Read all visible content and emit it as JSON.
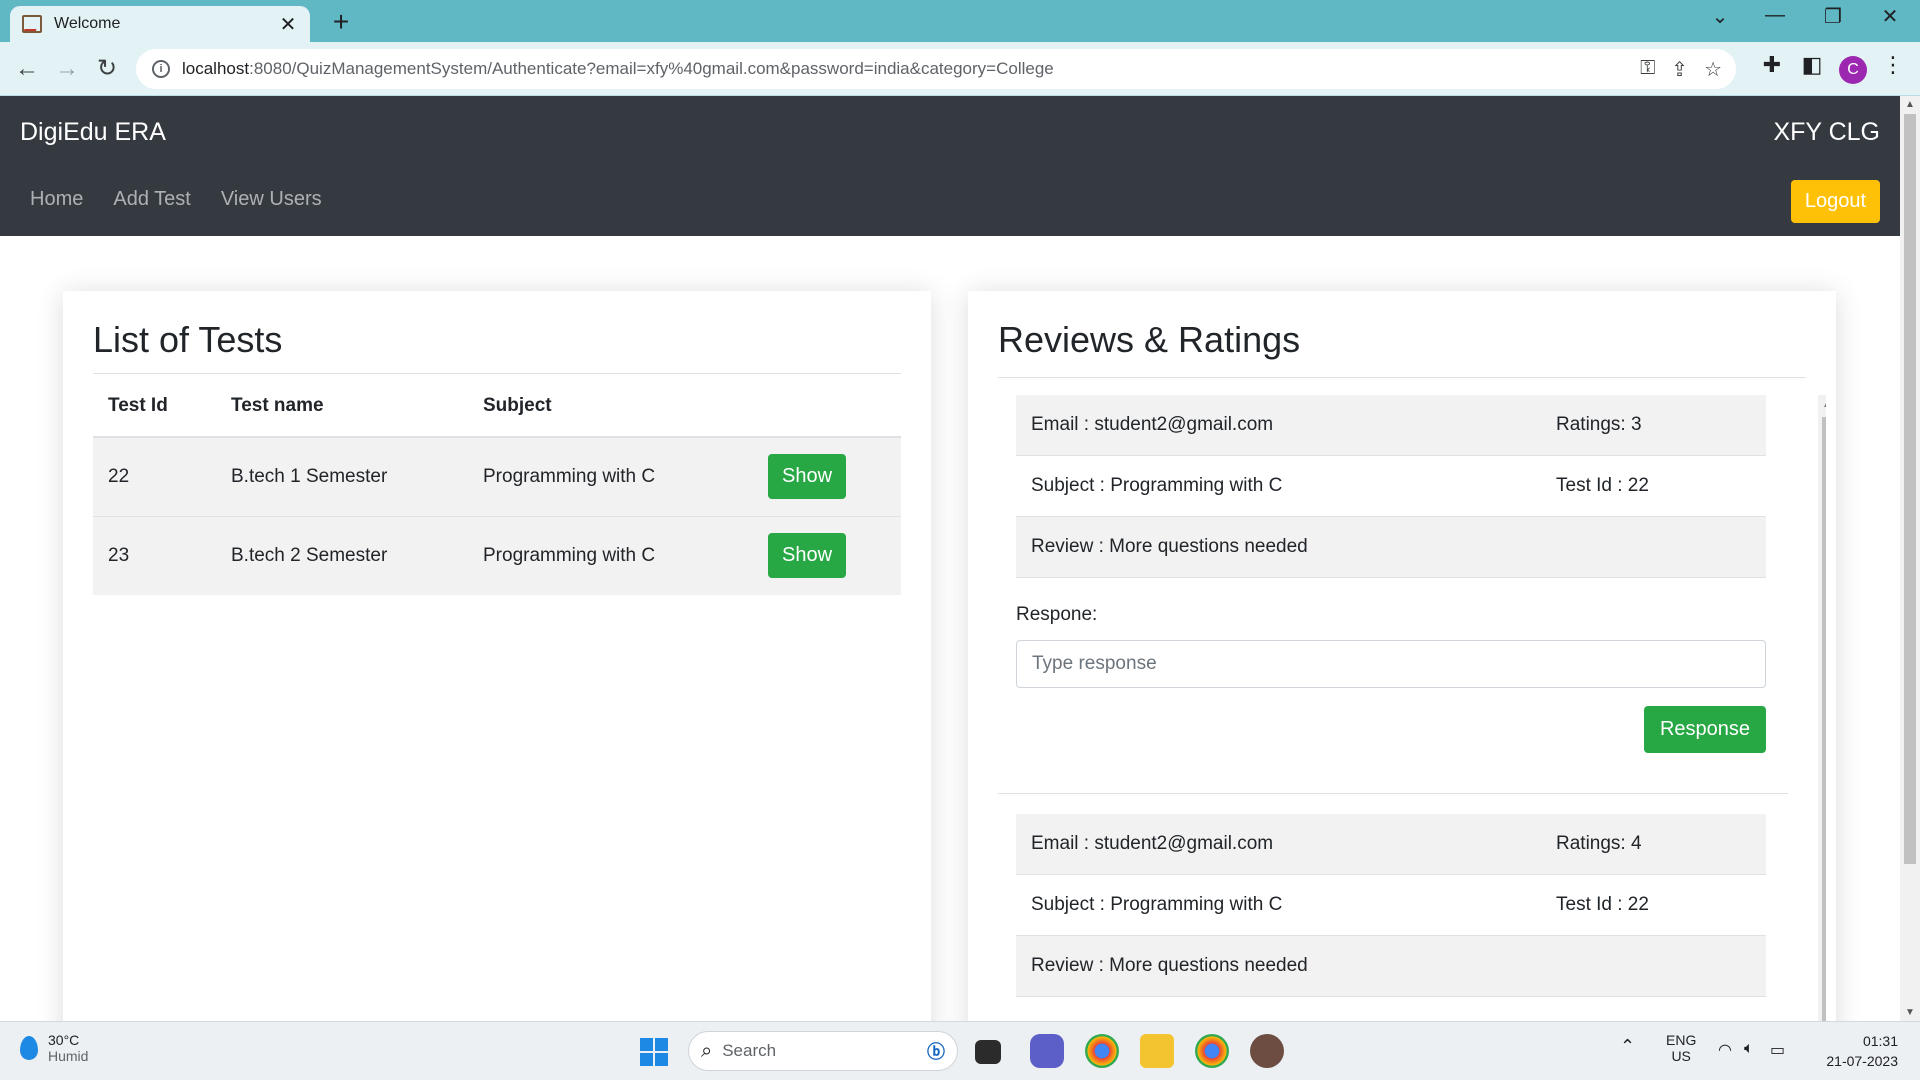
{
  "browser": {
    "tab_title": "Welcome",
    "url_host": "localhost",
    "url_rest": ":8080/QuizManagementSystem/Authenticate?email=xfy%40gmail.com&password=india&category=College",
    "profile_initial": "C"
  },
  "navbar": {
    "brand": "DigiEdu ERA",
    "college": "XFY CLG",
    "links": [
      "Home",
      "Add Test",
      "View Users"
    ],
    "logout_label": "Logout"
  },
  "tests": {
    "title": "List of Tests",
    "headers": [
      "Test Id",
      "Test name",
      "Subject"
    ],
    "rows": [
      {
        "id": "22",
        "name": "B.tech 1 Semester",
        "subject": "Programming with C",
        "action": "Show"
      },
      {
        "id": "23",
        "name": "B.tech 2 Semester",
        "subject": "Programming with C",
        "action": "Show"
      }
    ]
  },
  "reviews": {
    "title": "Reviews & Ratings",
    "response_label": "Respone:",
    "response_placeholder": "Type response",
    "response_button": "Response",
    "items": [
      {
        "email": "Email : student2@gmail.com",
        "rating": "Ratings: 3",
        "subject": "Subject : Programming with C",
        "test_id": "Test Id : 22",
        "review": "Review : More questions needed"
      },
      {
        "email": "Email : student2@gmail.com",
        "rating": "Ratings: 4",
        "subject": "Subject : Programming with C",
        "test_id": "Test Id : 22",
        "review": "Review : More questions needed"
      }
    ]
  },
  "taskbar": {
    "temp": "30°C",
    "weather": "Humid",
    "search": "Search",
    "lang1": "ENG",
    "lang2": "US",
    "time": "01:31",
    "date": "21-07-2023"
  }
}
